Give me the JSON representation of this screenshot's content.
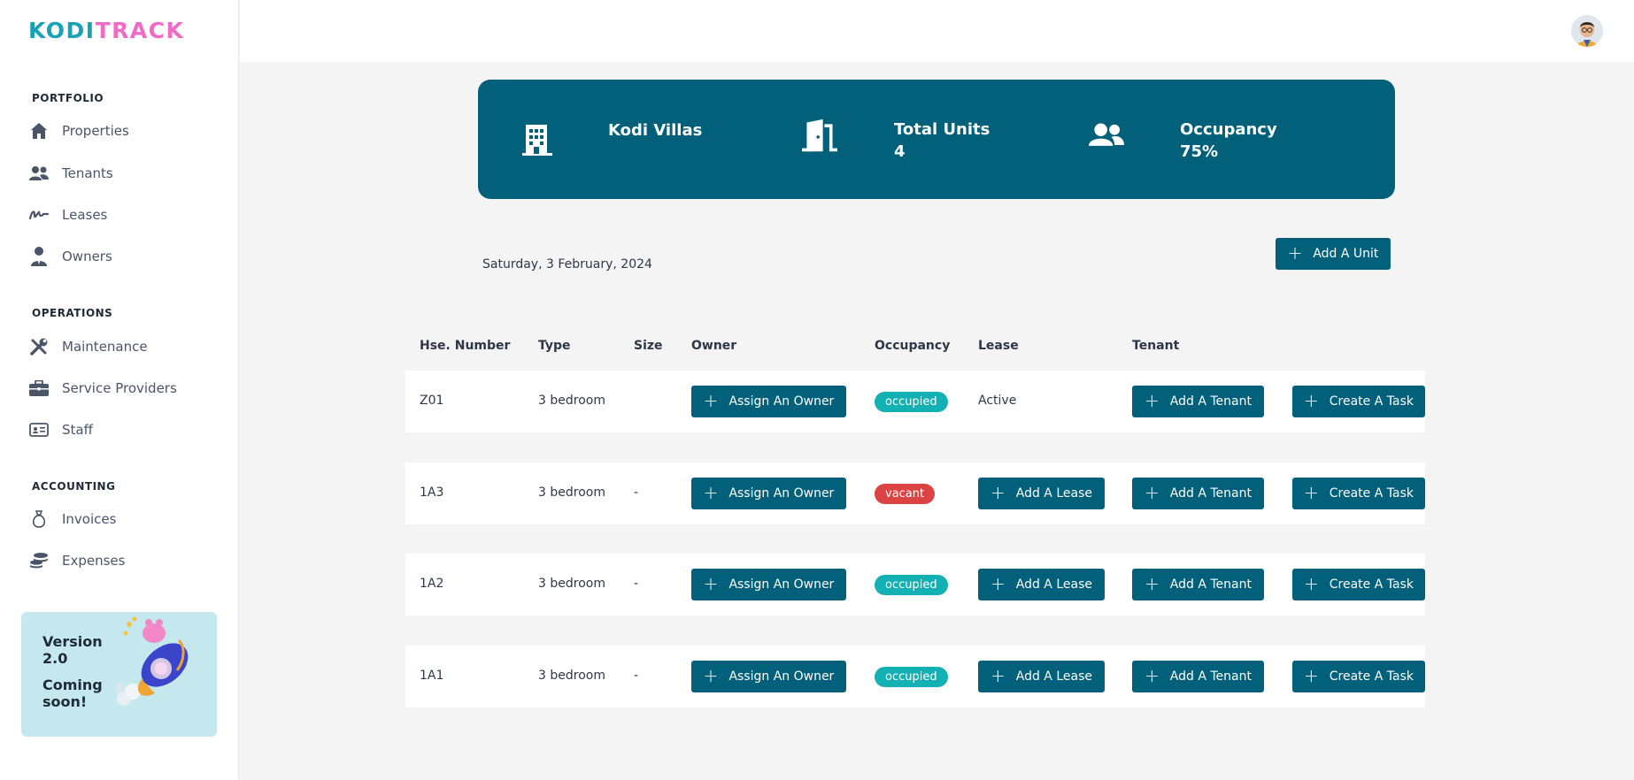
{
  "brand": {
    "part1": "KODI",
    "part2": "TRACK"
  },
  "sidebar": {
    "sections": [
      {
        "title": "PORTFOLIO",
        "items": [
          {
            "label": "Properties",
            "icon": "home-icon"
          },
          {
            "label": "Tenants",
            "icon": "users-icon"
          },
          {
            "label": "Leases",
            "icon": "signature-icon"
          },
          {
            "label": "Owners",
            "icon": "user-tie-icon"
          }
        ]
      },
      {
        "title": "OPERATIONS",
        "items": [
          {
            "label": "Maintenance",
            "icon": "tools-icon"
          },
          {
            "label": "Service Providers",
            "icon": "briefcase-icon"
          },
          {
            "label": "Staff",
            "icon": "id-card-icon"
          }
        ]
      },
      {
        "title": "ACCOUNTING",
        "items": [
          {
            "label": "Invoices",
            "icon": "money-bag-icon"
          },
          {
            "label": "Expenses",
            "icon": "coins-icon"
          }
        ]
      }
    ],
    "promo": {
      "line1": "Version",
      "line2": "2.0",
      "line3": "Coming",
      "line4": "soon!"
    }
  },
  "banner": {
    "property_name": "Kodi Villas",
    "units_label": "Total Units",
    "units_value": "4",
    "occupancy_label": "Occupancy",
    "occupancy_value": "75%"
  },
  "date": "Saturday, 3 February, 2024",
  "add_unit_label": "Add A Unit",
  "table": {
    "headers": [
      "Hse. Number",
      "Type",
      "Size",
      "Owner",
      "Occupancy",
      "Lease",
      "Tenant"
    ],
    "rows": [
      {
        "number": "Z01",
        "type": "3 bedroom",
        "size": "",
        "owner_action": "Assign An Owner",
        "occupancy": "occupied",
        "lease": "Active",
        "tenant_action": "Add A Tenant",
        "task_action": "Create A Task"
      },
      {
        "number": "1A3",
        "type": "3 bedroom",
        "size": "-",
        "owner_action": "Assign An Owner",
        "occupancy": "vacant",
        "lease_action": "Add A Lease",
        "tenant_action": "Add A Tenant",
        "task_action": "Create A Task"
      },
      {
        "number": "1A2",
        "type": "3 bedroom",
        "size": "-",
        "owner_action": "Assign An Owner",
        "occupancy": "occupied",
        "lease_action": "Add A Lease",
        "tenant_action": "Add A Tenant",
        "task_action": "Create A Task"
      },
      {
        "number": "1A1",
        "type": "3 bedroom",
        "size": "-",
        "owner_action": "Assign An Owner",
        "occupancy": "occupied",
        "lease_action": "Add A Lease",
        "tenant_action": "Add A Tenant",
        "task_action": "Create A Task"
      }
    ]
  },
  "colors": {
    "primary": "#02607a",
    "occupied": "#14b1b4",
    "vacant": "#dc4444",
    "brand_teal": "#17a2b8",
    "brand_pink": "#f06bc8"
  }
}
